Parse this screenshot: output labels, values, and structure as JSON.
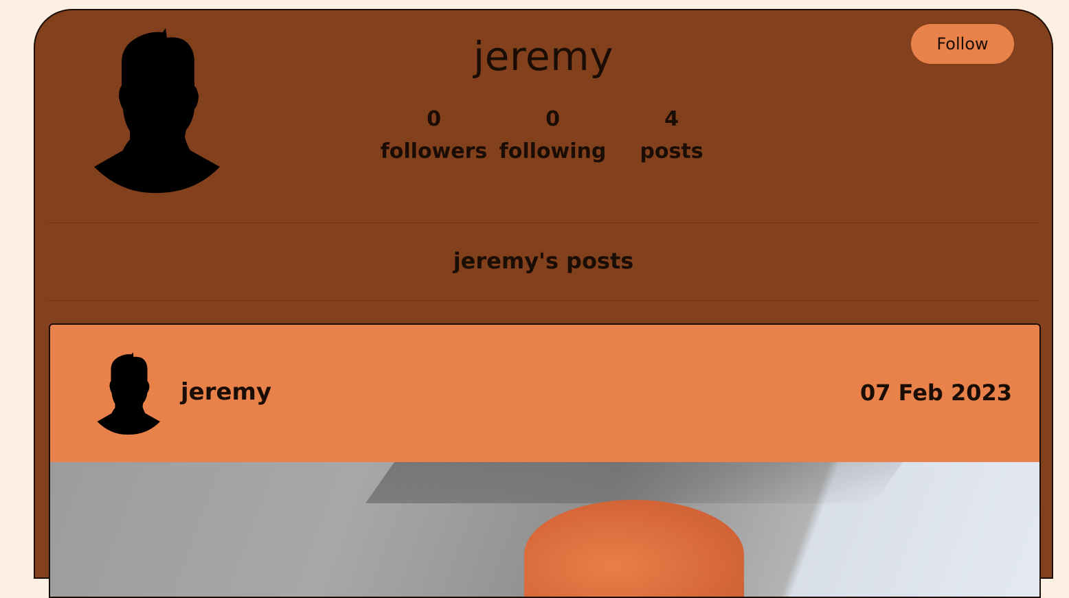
{
  "profile": {
    "username": "jeremy",
    "follow_label": "Follow",
    "stats": [
      {
        "count": "0",
        "label": "followers"
      },
      {
        "count": "0",
        "label": "following"
      },
      {
        "count": "4",
        "label": "posts"
      }
    ],
    "posts_heading": "jeremy's posts"
  },
  "posts": [
    {
      "author": "jeremy",
      "date": "07 Feb 2023"
    }
  ],
  "colors": {
    "page_background": "#fdf0e3",
    "card_background": "#82401c",
    "accent": "#e8824a",
    "text": "#1a0d05"
  },
  "icons": {
    "profile_avatar": "person-silhouette-icon",
    "post_avatar": "person-silhouette-icon"
  }
}
